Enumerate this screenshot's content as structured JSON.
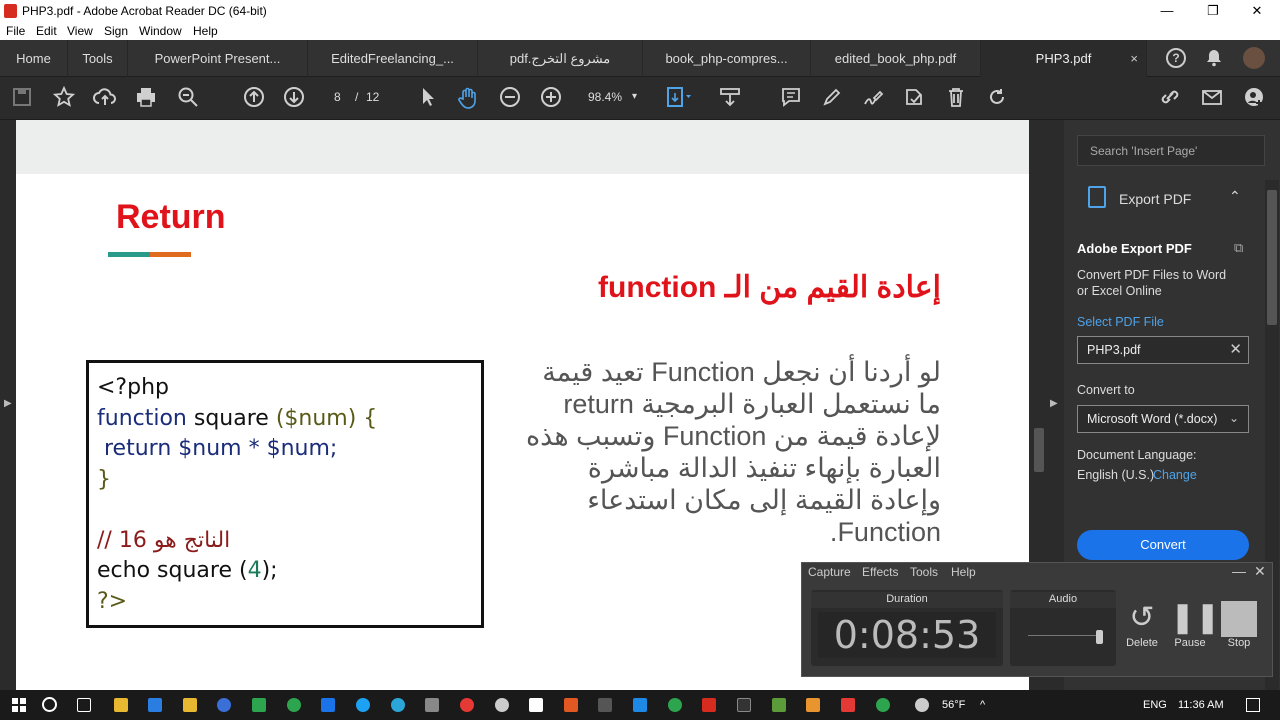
{
  "window": {
    "title": "PHP3.pdf - Adobe Acrobat Reader DC (64-bit)",
    "minimize": "—",
    "maximize": "❐",
    "close": "✕"
  },
  "menu": [
    "File",
    "Edit",
    "View",
    "Sign",
    "Window",
    "Help"
  ],
  "tabs": {
    "home": "Home",
    "tools": "Tools",
    "docs": [
      "PowerPoint Present...",
      "EditedFreelancing_...",
      "pdf.مشروع التخرج",
      "book_php-compres...",
      "edited_book_php.pdf",
      "PHP3.pdf"
    ],
    "close_active": "×",
    "help_icon": "?",
    "bell_icon": "🔔"
  },
  "toolbar": {
    "page_current": "8",
    "page_sep": "/",
    "page_total": "12",
    "zoom": "98.4%",
    "zoom_arrow": "▾"
  },
  "page": {
    "heading": "Return",
    "subheading": "إعادة القيم من الـ function",
    "code": {
      "line1": "<?php",
      "line2_kw": "function",
      "line2_name": " square ",
      "line2_rest": "($num) {",
      "line3_kw": "return",
      "line3_rest": " $num * $num;",
      "line4": "}",
      "line6": "// الناتج هو 16",
      "line7_a": "echo square (",
      "line7_num": "4",
      "line7_b": ");",
      "line8": "?>"
    },
    "body_text": "لو أردنا أن نجعل Function تعيد قيمة ما نستعمل العبارة البرمجية return لإعادة قيمة من Function وتسبب هذه العبارة بإنهاء تنفيذ الدالة مباشرة وإعادة القيمة إلى مكان استدعاء Function."
  },
  "right_panel": {
    "search_placeholder": "Search 'Insert Page'",
    "export_title": "Export PDF",
    "export_chevron": "⌃",
    "adobe_export": "Adobe Export PDF",
    "desc_line1": "Convert PDF Files to Word",
    "desc_line2": "or Excel Online",
    "select_file": "Select PDF File",
    "file_name": "PHP3.pdf",
    "file_clear": "✕",
    "convert_to": "Convert to",
    "convert_option": "Microsoft Word (*.docx)",
    "convert_chevron": "⌄",
    "doc_language": "Document Language:",
    "language": "English (U.S.)",
    "change": "Change",
    "convert_button": "Convert"
  },
  "recorder": {
    "menu": [
      "Capture",
      "Effects",
      "Tools",
      "Help"
    ],
    "minimize": "—",
    "close": "✕",
    "duration_label": "Duration",
    "duration": "0:08:53",
    "audio_label": "Audio",
    "delete": "Delete",
    "pause": "Pause",
    "stop": "Stop"
  },
  "taskbar": {
    "weather": "56°F",
    "language": "ENG",
    "time": "11:36 AM"
  },
  "colors": {
    "heading_red": "#e0121a",
    "accent_blue": "#4fa3e8",
    "convert_blue": "#1a73e8"
  }
}
